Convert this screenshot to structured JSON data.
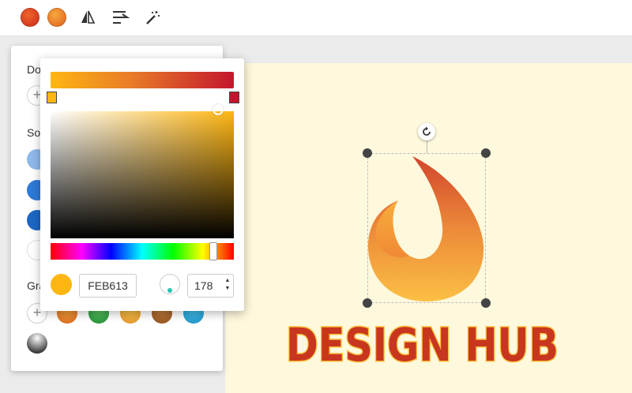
{
  "toolbar": {
    "swatch_1": "solid red-orange gradient swatch",
    "swatch_2": "orange gradient swatch",
    "icons": [
      "flip-horizontal-icon",
      "align-icon",
      "magic-wand-icon"
    ]
  },
  "side_panel": {
    "document_label": "Do",
    "solid_label": "So",
    "gradient_label": "Gra",
    "solid_colors": [
      "#8fb9ea",
      "#2f7ad8",
      "#1c67c5",
      "#ffffff"
    ],
    "gradient_colors": [
      "#e2852a",
      "#36a744",
      "#eeab2e",
      "#a86a2e",
      "#29a6d8"
    ]
  },
  "picker": {
    "gradient_start": "#feb613",
    "gradient_end": "#c3162e",
    "hex_value": "FEB613",
    "angle_value": "178",
    "spin_up": "▲",
    "spin_down": "▼",
    "current_color": "#feb613"
  },
  "canvas": {
    "background": "#fef8dc",
    "logo_text": "DESIGN HUB"
  }
}
